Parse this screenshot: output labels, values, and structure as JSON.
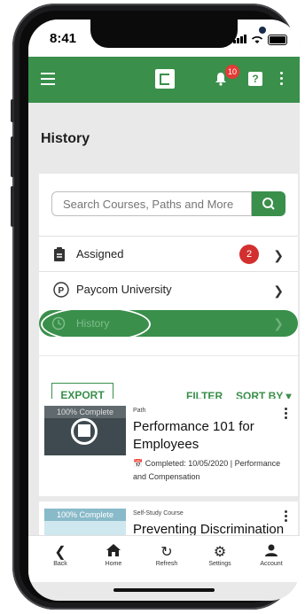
{
  "status_bar": {
    "time": "8:41"
  },
  "header": {
    "notification_count": "10",
    "help_label": "?"
  },
  "page": {
    "title": "History"
  },
  "search": {
    "placeholder": "Search Courses, Paths and More"
  },
  "nav": {
    "items": [
      {
        "label": "Assigned",
        "badge": "2"
      },
      {
        "label": "Paycom University"
      },
      {
        "label": "History",
        "active": true
      }
    ]
  },
  "actions": {
    "export_label": "EXPORT",
    "filter_label": "FILTER",
    "sort_label": "SORT BY ▾"
  },
  "courses": [
    {
      "progress": "100% Complete",
      "type": "Path",
      "title": "Performance 101 for Employees",
      "completed": "Completed: 10/05/2020 | Performance and Compensation"
    },
    {
      "progress": "100% Complete",
      "type": "Self-Study Course",
      "title": "Preventing Discrimination and"
    }
  ],
  "bottom_nav": [
    "Back",
    "Home",
    "Refresh",
    "Settings",
    "Account"
  ],
  "colors": {
    "brand_green": "#3a8f4b",
    "badge_red": "#d32f2f"
  }
}
